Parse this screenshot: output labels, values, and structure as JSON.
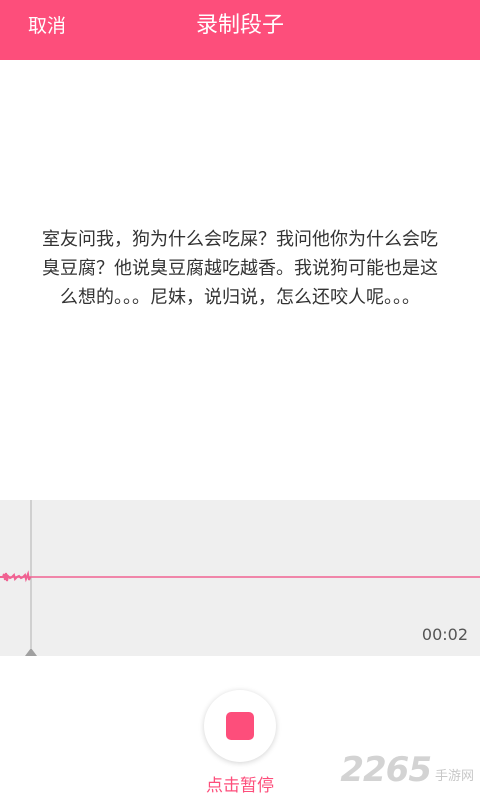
{
  "header": {
    "cancel_label": "取消",
    "title": "录制段子"
  },
  "content": {
    "joke_text": "室友问我，狗为什么会吃屎？我问他你为什么会吃臭豆腐？他说臭豆腐越吃越香。我说狗可能也是这么想的。。。尼妹，说归说，怎么还咬人呢。。。"
  },
  "recorder": {
    "elapsed": "00:02",
    "stop_icon": "stop-square-icon",
    "pause_label": "点击暂停"
  },
  "watermark": {
    "number": "2265",
    "site": "手游网"
  },
  "colors": {
    "accent": "#fd4e7b",
    "wave_line": "#f06292",
    "panel_bg": "#efefef",
    "text": "#333333"
  }
}
